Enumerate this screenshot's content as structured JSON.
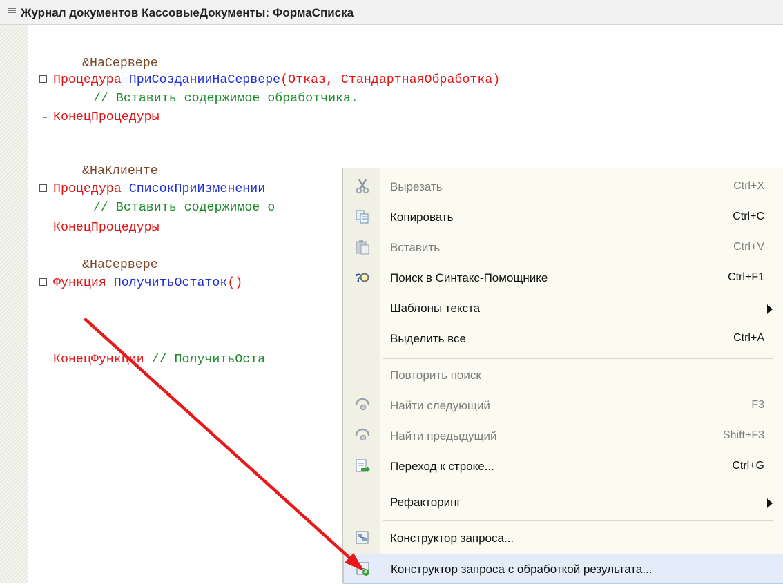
{
  "window": {
    "title": "Журнал документов КассовыеДокументы: ФормаСписка"
  },
  "code": {
    "line1": "&НаСервере",
    "line2_kw": "Процедура",
    "line2_name": "ПриСозданииНаСервере",
    "line2_args": "(Отказ, СтандартнаяОбработка)",
    "line3": "// Вставить содержимое обработчика.",
    "line4": "КонецПроцедуры",
    "line5": "&НаКлиенте",
    "line6_kw": "Процедура",
    "line6_name": "СписокПриИзменении",
    "line7": "// Вставить содержимое о",
    "line8": "КонецПроцедуры",
    "line9": "&НаСервере",
    "line10_kw": "Функция",
    "line10_name": "ПолучитьОстаток",
    "line10_args": "()",
    "line11_kw": "КонецФункции",
    "line11_cm": "// ПолучитьОста"
  },
  "context_menu": {
    "cut": {
      "label": "Вырезать",
      "shortcut": "Ctrl+X",
      "icon": "scissors-icon"
    },
    "copy": {
      "label": "Копировать",
      "shortcut": "Ctrl+C",
      "icon": "copy-icon"
    },
    "paste": {
      "label": "Вставить",
      "shortcut": "Ctrl+V",
      "icon": "paste-icon"
    },
    "syntax_help": {
      "label": "Поиск в Синтакс-Помощнике",
      "shortcut": "Ctrl+F1",
      "icon": "help-search-icon"
    },
    "templates": {
      "label": "Шаблоны текста"
    },
    "select_all": {
      "label": "Выделить все",
      "shortcut": "Ctrl+A"
    },
    "repeat_search": {
      "label": "Повторить поиск"
    },
    "find_next": {
      "label": "Найти следующий",
      "shortcut": "F3",
      "icon": "find-next-icon"
    },
    "find_prev": {
      "label": "Найти предыдущий",
      "shortcut": "Shift+F3",
      "icon": "find-prev-icon"
    },
    "goto_line": {
      "label": "Переход к строке...",
      "shortcut": "Ctrl+G",
      "icon": "goto-line-icon"
    },
    "refactoring": {
      "label": "Рефакторинг"
    },
    "query_builder": {
      "label": "Конструктор запроса...",
      "icon": "query-builder-icon"
    },
    "query_builder_result": {
      "label": "Конструктор запроса с обработкой результата...",
      "icon": "query-builder-result-icon"
    }
  },
  "colors": {
    "keyword": "#e01616",
    "identifier": "#1d2fd6",
    "comment": "#1c8a2c",
    "directive": "#7a4a2c",
    "annotation_arrow": "#e8191a",
    "highlight": "#e3ecf8"
  }
}
